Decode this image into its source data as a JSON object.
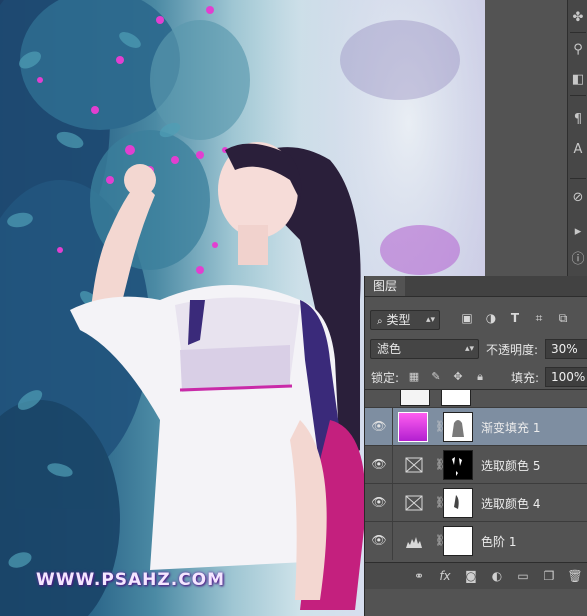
{
  "watermark": "WWW.PSAHZ.COM",
  "layers_panel": {
    "tab_label": "图层",
    "filter_kind": "类型",
    "blend_mode": "滤色",
    "opacity_label": "不透明度:",
    "opacity_value": "30%",
    "lock_label": "锁定:",
    "fill_label": "填充:",
    "fill_value": "100%",
    "layers": [
      {
        "name": "渐变填充 1",
        "selected": true
      },
      {
        "name": "选取颜色 5",
        "selected": false
      },
      {
        "name": "选取颜色 4",
        "selected": false
      },
      {
        "name": "色阶 1",
        "selected": false
      }
    ]
  },
  "icons": {
    "filter": [
      "image-filter-icon",
      "adjustment-filter-icon",
      "type-filter-icon",
      "shape-filter-icon",
      "smart-object-filter-icon"
    ],
    "lock": [
      "lock-transparent-icon",
      "lock-pixels-icon",
      "lock-position-icon",
      "lock-all-icon"
    ],
    "bottom": [
      "link-layers-icon",
      "fx-icon",
      "add-mask-icon",
      "new-adjustment-icon",
      "new-group-icon",
      "new-layer-icon",
      "delete-layer-icon"
    ]
  },
  "colors": {
    "selected_row": "#7e8ea1",
    "panel_bg": "#535353",
    "gradient_thumb": "#e83ed6"
  }
}
